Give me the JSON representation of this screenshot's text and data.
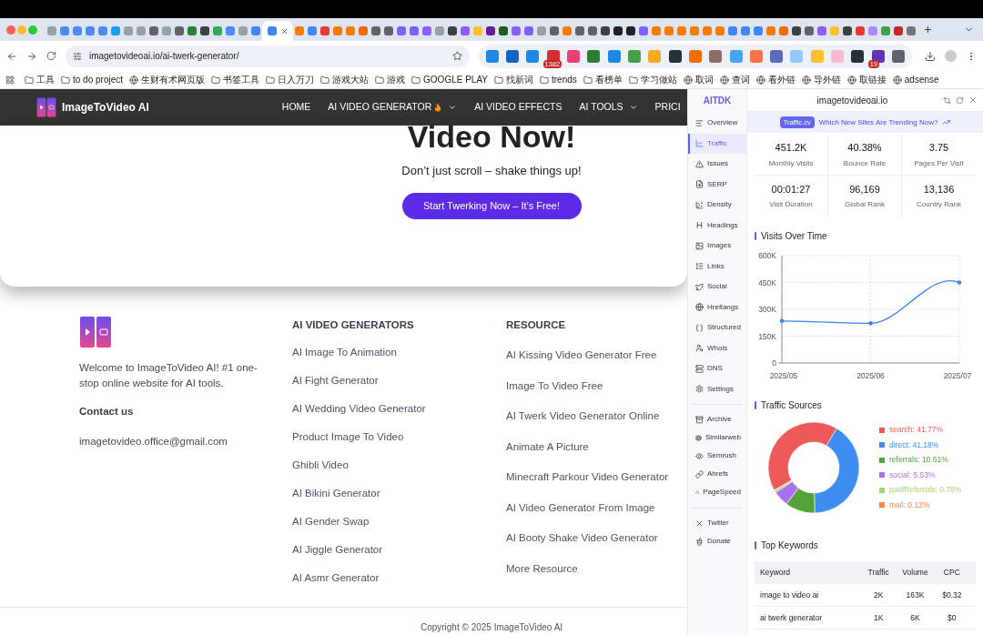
{
  "browser": {
    "tabs": [
      {
        "color": "#9aa0a6",
        "selected": false
      },
      {
        "color": "#4c8bf5",
        "selected": false
      },
      {
        "color": "#4c8bf5",
        "selected": false
      },
      {
        "color": "#4c8bf5",
        "selected": false
      },
      {
        "color": "#4c8bf5",
        "selected": false
      },
      {
        "color": "#1d9bf0",
        "selected": false
      },
      {
        "color": "#9aa0a6",
        "selected": false
      },
      {
        "color": "#9aa0a6",
        "selected": false
      },
      {
        "color": "#5f6368",
        "selected": false
      },
      {
        "color": "#9aa0a6",
        "selected": false
      },
      {
        "color": "#5f6368",
        "selected": false
      },
      {
        "color": "#2e7d32",
        "selected": false
      },
      {
        "color": "#3c4043",
        "selected": false
      },
      {
        "color": "#34a853",
        "selected": false
      },
      {
        "color": "#4c8bf5",
        "selected": false
      },
      {
        "color": "#9aa0a6",
        "selected": false
      },
      {
        "color": "#4285f4",
        "selected": false
      },
      {
        "color": "#4285f4",
        "selected": true
      },
      {
        "color": "#f57c00",
        "selected": false
      },
      {
        "color": "#4285f4",
        "selected": false
      },
      {
        "color": "#e53935",
        "selected": false
      },
      {
        "color": "#f57c00",
        "selected": false
      },
      {
        "color": "#f57c00",
        "selected": false
      },
      {
        "color": "#ef6c00",
        "selected": false
      },
      {
        "color": "#5f6368",
        "selected": false
      },
      {
        "color": "#5f6368",
        "selected": false
      },
      {
        "color": "#7b61ff",
        "selected": false
      },
      {
        "color": "#7b61ff",
        "selected": false
      },
      {
        "color": "#8e5cf7",
        "selected": false
      },
      {
        "color": "#9aa0a6",
        "selected": false
      },
      {
        "color": "#3c4043",
        "selected": false
      },
      {
        "color": "#8e5cf7",
        "selected": false
      },
      {
        "color": "#fbc02d",
        "selected": false
      },
      {
        "color": "#6a1b9a",
        "selected": false
      },
      {
        "color": "#1b5e20",
        "selected": false
      },
      {
        "color": "#8e5cf7",
        "selected": false
      },
      {
        "color": "#7b61ff",
        "selected": false
      },
      {
        "color": "#9aa0a6",
        "selected": false
      },
      {
        "color": "#5f6368",
        "selected": false
      },
      {
        "color": "#f57c00",
        "selected": false
      },
      {
        "color": "#5f6368",
        "selected": false
      },
      {
        "color": "#5f6368",
        "selected": false
      },
      {
        "color": "#3c4043",
        "selected": false
      },
      {
        "color": "#202124",
        "selected": false
      },
      {
        "color": "#202124",
        "selected": false
      },
      {
        "color": "#7b61ff",
        "selected": false
      },
      {
        "color": "#f57c00",
        "selected": false
      },
      {
        "color": "#f57c00",
        "selected": false
      },
      {
        "color": "#f57c00",
        "selected": false
      },
      {
        "color": "#f57c00",
        "selected": false
      },
      {
        "color": "#f57c00",
        "selected": false
      },
      {
        "color": "#f57c00",
        "selected": false
      },
      {
        "color": "#4285f4",
        "selected": false
      },
      {
        "color": "#4285f4",
        "selected": false
      },
      {
        "color": "#4285f4",
        "selected": false
      },
      {
        "color": "#f57c00",
        "selected": false
      },
      {
        "color": "#ef6c00",
        "selected": false
      },
      {
        "color": "#3c4043",
        "selected": false
      },
      {
        "color": "#5f6368",
        "selected": false
      },
      {
        "color": "#8e5cf7",
        "selected": false
      },
      {
        "color": "#fbc02d",
        "selected": false
      },
      {
        "color": "#3c4043",
        "selected": false
      },
      {
        "color": "#e53935",
        "selected": false
      },
      {
        "color": "#a78bfa",
        "selected": false
      },
      {
        "color": "#43a047",
        "selected": false
      },
      {
        "color": "#c62828",
        "selected": false
      },
      {
        "color": "#757575",
        "selected": false
      }
    ],
    "url": "imagetovideoai.io/ai-twerk-generator/",
    "extensions": [
      {
        "color": "#1e88e5"
      },
      {
        "color": "#1565c0"
      },
      {
        "color": "#1e88e5"
      },
      {
        "color": "#d32f2f",
        "badge": "1382"
      },
      {
        "color": "#ec407a"
      },
      {
        "color": "#2e7d32"
      },
      {
        "color": "#1e88e5"
      },
      {
        "color": "#43a047"
      },
      {
        "color": "#f9a825"
      },
      {
        "color": "#263238"
      },
      {
        "color": "#ef6c00"
      },
      {
        "color": "#8d6e63"
      },
      {
        "color": "#42a5f5"
      },
      {
        "color": "#ff7043"
      },
      {
        "color": "#5c6bc0"
      },
      {
        "color": "#90caf9"
      },
      {
        "color": "#fbc02d"
      },
      {
        "color": "#f8bbd0"
      },
      {
        "color": "#263238"
      },
      {
        "color": "#5e35b1",
        "badge": "19"
      },
      {
        "color": "#5f6368"
      }
    ],
    "bookmarks": [
      {
        "kind": "folder",
        "label": "工具"
      },
      {
        "kind": "folder",
        "label": "to do project"
      },
      {
        "kind": "site",
        "label": "生财有术网页版"
      },
      {
        "kind": "folder",
        "label": "书签工具"
      },
      {
        "kind": "folder",
        "label": "日入万刀"
      },
      {
        "kind": "folder",
        "label": "游戏大站"
      },
      {
        "kind": "folder",
        "label": "游戏"
      },
      {
        "kind": "folder",
        "label": "GOOGLE PLAY"
      },
      {
        "kind": "folder",
        "label": "找新词"
      },
      {
        "kind": "folder",
        "label": "trends"
      },
      {
        "kind": "folder",
        "label": "看榜单"
      },
      {
        "kind": "folder",
        "label": "学习做站"
      },
      {
        "kind": "site",
        "label": "取词"
      },
      {
        "kind": "site",
        "label": "查词"
      },
      {
        "kind": "site",
        "label": "看外链"
      },
      {
        "kind": "site",
        "label": "导外链"
      },
      {
        "kind": "site",
        "label": "取链接"
      },
      {
        "kind": "site",
        "label": "adsense"
      }
    ]
  },
  "site": {
    "brand": "ImageToVideo AI",
    "nav": [
      {
        "label": "HOME",
        "flame": false,
        "dropdown": false
      },
      {
        "label": "AI VIDEO GENERATOR",
        "flame": true,
        "dropdown": true
      },
      {
        "label": "AI VIDEO EFFECTS",
        "flame": false,
        "dropdown": false
      },
      {
        "label": "AI TOOLS",
        "flame": false,
        "dropdown": true
      },
      {
        "label": "PRICI",
        "flame": false,
        "dropdown": false
      }
    ],
    "hero": {
      "heading": "Video Now!",
      "subtitle": "Don’t just scroll – shake things up!",
      "cta": "Start Twerking Now – It’s Free!"
    },
    "footer": {
      "about": "Welcome to ImageToVideo AI! #1 one-stop online website for AI tools.",
      "contact_heading": "Contact us",
      "email": "imagetovideo.office@gmail.com",
      "columns": [
        {
          "heading": "AI VIDEO GENERATORS",
          "links": [
            "AI Image To Animation",
            "AI Fight Generator",
            "AI Wedding Video Generator",
            "Product Image To Video",
            "Ghibli Video",
            "AI Bikini Generator",
            "AI Gender Swap",
            "AI Jiggle Generator",
            "AI Asmr Generator"
          ]
        },
        {
          "heading": "RESOURCE",
          "links": [
            "AI Kissing Video Generator Free",
            "Image To Video Free",
            "AI Twerk Video Generator Online",
            "Animate A Picture",
            "Minecraft Parkour Video Generator",
            "AI Video Generator From Image",
            "AI Booty Shake Video Generator",
            "More Resource"
          ]
        }
      ],
      "copyright": "Copyright © 2025 ImageToVideo AI"
    }
  },
  "panel": {
    "brand": "AITDK",
    "domain": "imagetovideoai.io",
    "sidebar": [
      [
        {
          "label": "Overview",
          "selected": false
        },
        {
          "label": "Traffic",
          "selected": true
        },
        {
          "label": "Issues",
          "selected": false
        },
        {
          "label": "SERP",
          "selected": false
        },
        {
          "label": "Density",
          "selected": false
        },
        {
          "label": "Headings",
          "selected": false
        },
        {
          "label": "Images",
          "selected": false
        },
        {
          "label": "Links",
          "selected": false
        },
        {
          "label": "Social",
          "selected": false
        },
        {
          "label": "Hreflangs",
          "selected": false
        },
        {
          "label": "Structured",
          "selected": false
        },
        {
          "label": "Whois",
          "selected": false
        },
        {
          "label": "DNS",
          "selected": false
        },
        {
          "label": "Settings",
          "selected": false
        }
      ],
      [
        {
          "label": "Archive",
          "selected": false
        },
        {
          "label": "Similarweb",
          "selected": false
        },
        {
          "label": "Semrush",
          "selected": false
        },
        {
          "label": "Ahrefs",
          "selected": false
        },
        {
          "label": "PageSpeed",
          "selected": false
        }
      ],
      [
        {
          "label": "Twitter",
          "selected": false
        },
        {
          "label": "Donate",
          "selected": false
        }
      ]
    ],
    "banner": {
      "badge": "Traffic.cv",
      "text": "Which New Sites Are Trending Now?"
    },
    "stats": [
      {
        "value": "451.2K",
        "label": "Monthly Visits"
      },
      {
        "value": "40.38%",
        "label": "Bounce Rate"
      },
      {
        "value": "3.75",
        "label": "Pages Per Visit"
      },
      {
        "value": "00:01:27",
        "label": "Visit Duration"
      },
      {
        "value": "96,169",
        "label": "Global Rank"
      },
      {
        "value": "13,136",
        "label": "Country Rank"
      }
    ],
    "visits": {
      "chart_data": {
        "type": "line",
        "title": "Visits Over Time",
        "categories": [
          "2025/05",
          "2025/06",
          "2025/07"
        ],
        "grid": true,
        "series": [
          {
            "color": "#3b82f6",
            "values": [
              235000,
              222000,
              450000
            ]
          }
        ],
        "ylim": [
          0,
          600000
        ],
        "yticks": [
          {
            "value": 0,
            "label": "0"
          },
          {
            "value": 150000,
            "label": "150K"
          },
          {
            "value": 300000,
            "label": "300K"
          },
          {
            "value": 450000,
            "label": "450K"
          },
          {
            "value": 600000,
            "label": "600K"
          }
        ]
      }
    },
    "traffic_sources": {
      "title": "Traffic Sources",
      "chart_data": {
        "type": "donut",
        "categories": [
          "search: 41.77%",
          "direct: 41.18%",
          "referrals: 10.61%",
          "social: 5.53%",
          "paidReferrals: 0.78%",
          "mail: 0.12%"
        ],
        "values": [
          41.77,
          41.18,
          10.61,
          5.53,
          0.78,
          0.12
        ]
      },
      "legend": [
        {
          "color": "#ee5a5a"
        },
        {
          "color": "#3d8ef0"
        },
        {
          "color": "#52a33a"
        },
        {
          "color": "#a970f2"
        },
        {
          "color": "#a3d56e"
        },
        {
          "color": "#f08b4a"
        }
      ]
    },
    "keywords": {
      "title": "Top Keywords",
      "columns": [
        "Keyword",
        "Traffic",
        "Volume",
        "CPC"
      ],
      "rows": [
        [
          "image to video ai",
          "2K",
          "163K",
          "$0.32"
        ],
        [
          "ai twerk generator",
          "1K",
          "6K",
          "$0"
        ]
      ]
    }
  }
}
